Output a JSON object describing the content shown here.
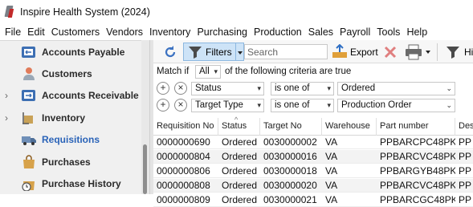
{
  "window": {
    "title": "Inspire Health System (2024)"
  },
  "menu": [
    "File",
    "Edit",
    "Customers",
    "Vendors",
    "Inventory",
    "Purchasing",
    "Production",
    "Sales",
    "Payroll",
    "Tools",
    "Help"
  ],
  "sidebar": {
    "items": [
      {
        "label": "Accounts Payable",
        "icon": "accounts-payable-icon",
        "expandable": false,
        "selected": false
      },
      {
        "label": "Customers",
        "icon": "customers-icon",
        "expandable": false,
        "selected": false
      },
      {
        "label": "Accounts Receivable",
        "icon": "accounts-receivable-icon",
        "expandable": true,
        "selected": false
      },
      {
        "label": "Inventory",
        "icon": "inventory-icon",
        "expandable": true,
        "selected": false
      },
      {
        "label": "Requisitions",
        "icon": "requisitions-icon",
        "expandable": false,
        "selected": true
      },
      {
        "label": "Purchases",
        "icon": "purchases-icon",
        "expandable": false,
        "selected": false
      },
      {
        "label": "Purchase History",
        "icon": "purchase-history-icon",
        "expandable": false,
        "selected": false
      }
    ]
  },
  "toolbar": {
    "filters_label": "Filters",
    "search_placeholder": "Search",
    "export_label": "Export",
    "hide_label": "Hi"
  },
  "filter": {
    "match_label": "Match if",
    "match_value": "All",
    "match_suffix": "of the following criteria are true",
    "criteria": [
      {
        "field": "Status",
        "operator": "is one of",
        "value": "Ordered"
      },
      {
        "field": "Target Type",
        "operator": "is one of",
        "value": "Production Order"
      }
    ]
  },
  "grid": {
    "columns": [
      "Requisition No",
      "Status",
      "Target No",
      "Warehouse",
      "Part number",
      "Desc"
    ],
    "rows": [
      [
        "0000000690",
        "Ordered",
        "0030000002",
        "VA",
        "PPBARCPC48PK",
        "PP E"
      ],
      [
        "0000000804",
        "Ordered",
        "0030000016",
        "VA",
        "PPBARCVC48PK",
        "PP E"
      ],
      [
        "0000000806",
        "Ordered",
        "0030000018",
        "VA",
        "PPBARGYB48PK",
        "PP E"
      ],
      [
        "0000000808",
        "Ordered",
        "0030000020",
        "VA",
        "PPBARCVC48PK",
        "PP E"
      ],
      [
        "0000000809",
        "Ordered",
        "0030000021",
        "VA",
        "PPBARCGC48PK",
        "PP E"
      ]
    ]
  },
  "colors": {
    "accent": "#2a63b8",
    "filter_active": "#cde3f7"
  }
}
